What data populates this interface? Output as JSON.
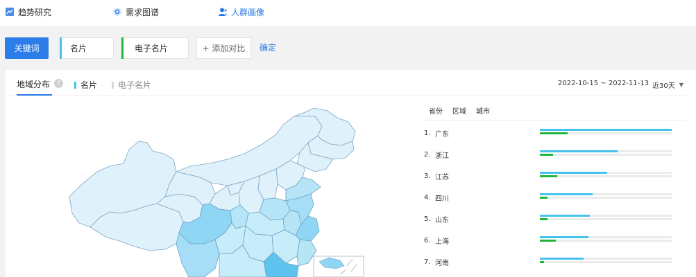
{
  "nav": {
    "items": [
      {
        "label": "趋势研究",
        "icon": "trend-chart-icon"
      },
      {
        "label": "需求图谱",
        "icon": "radar-icon"
      },
      {
        "label": "人群画像",
        "icon": "users-icon"
      }
    ]
  },
  "toolbar": {
    "keyword_label": "关键词",
    "keywords": [
      {
        "label": "名片",
        "color": "#44c2ec"
      },
      {
        "label": "电子名片",
        "color": "#1fb53a"
      }
    ],
    "add_compare_label": "+ 添加对比",
    "confirm_label": "确定"
  },
  "panel": {
    "title": "地域分布",
    "help": "?",
    "legend": [
      {
        "label": "名片",
        "color": "#44c2ec"
      },
      {
        "label": "电子名片",
        "color": "#d9d9d9"
      }
    ],
    "date_range": "2022-10-15 ~ 2022-11-13",
    "period": "近30天"
  },
  "ranking": {
    "tabs": [
      "省份",
      "区域",
      "城市"
    ],
    "rows": [
      {
        "rank": "1.",
        "name": "广东",
        "primary": 1.0,
        "secondary": 0.21
      },
      {
        "rank": "2.",
        "name": "浙江",
        "primary": 0.59,
        "secondary": 0.1
      },
      {
        "rank": "3.",
        "name": "江苏",
        "primary": 0.51,
        "secondary": 0.13
      },
      {
        "rank": "4.",
        "name": "四川",
        "primary": 0.4,
        "secondary": 0.06
      },
      {
        "rank": "5.",
        "name": "山东",
        "primary": 0.38,
        "secondary": 0.06
      },
      {
        "rank": "6.",
        "name": "上海",
        "primary": 0.37,
        "secondary": 0.12
      },
      {
        "rank": "7.",
        "name": "河南",
        "primary": 0.33,
        "secondary": 0.03
      }
    ],
    "colors": {
      "primary": "#44c2ec",
      "secondary": "#1fb53a",
      "track": "#ebebeb"
    }
  }
}
